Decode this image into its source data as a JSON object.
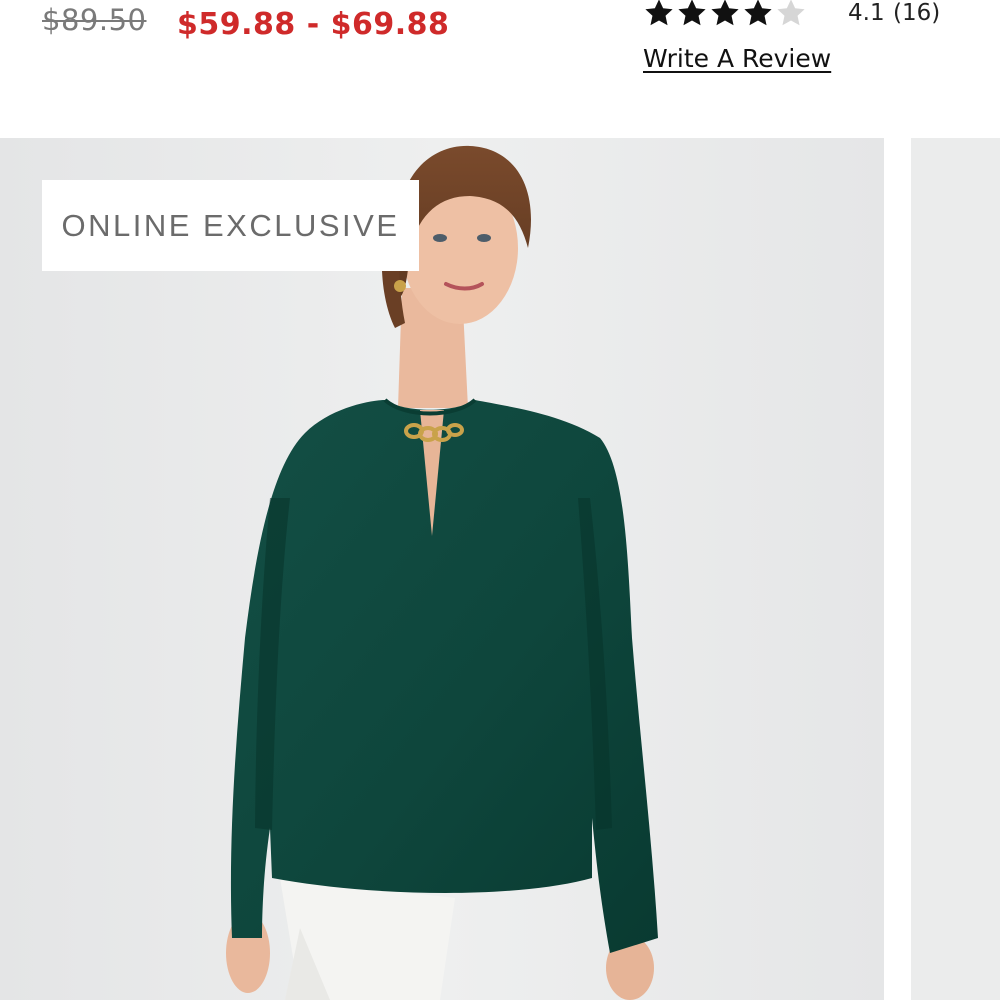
{
  "pricing": {
    "original_price": "$89.50",
    "sale_price": "$59.88 - $69.88"
  },
  "rating": {
    "value": "4.1",
    "count": "(16)",
    "stars_filled": 4,
    "stars_total": 5,
    "write_review_label": "Write A Review"
  },
  "product_image": {
    "badge_label": "ONLINE EXCLUSIVE"
  },
  "colors": {
    "sale_red": "#cf2a2a",
    "strike_gray": "#7a7a7a",
    "top_green": "#0f4a40",
    "photo_background": "#e9eaeb"
  },
  "icons": {
    "star_filled": "star-filled-icon",
    "star_empty": "star-empty-icon"
  }
}
